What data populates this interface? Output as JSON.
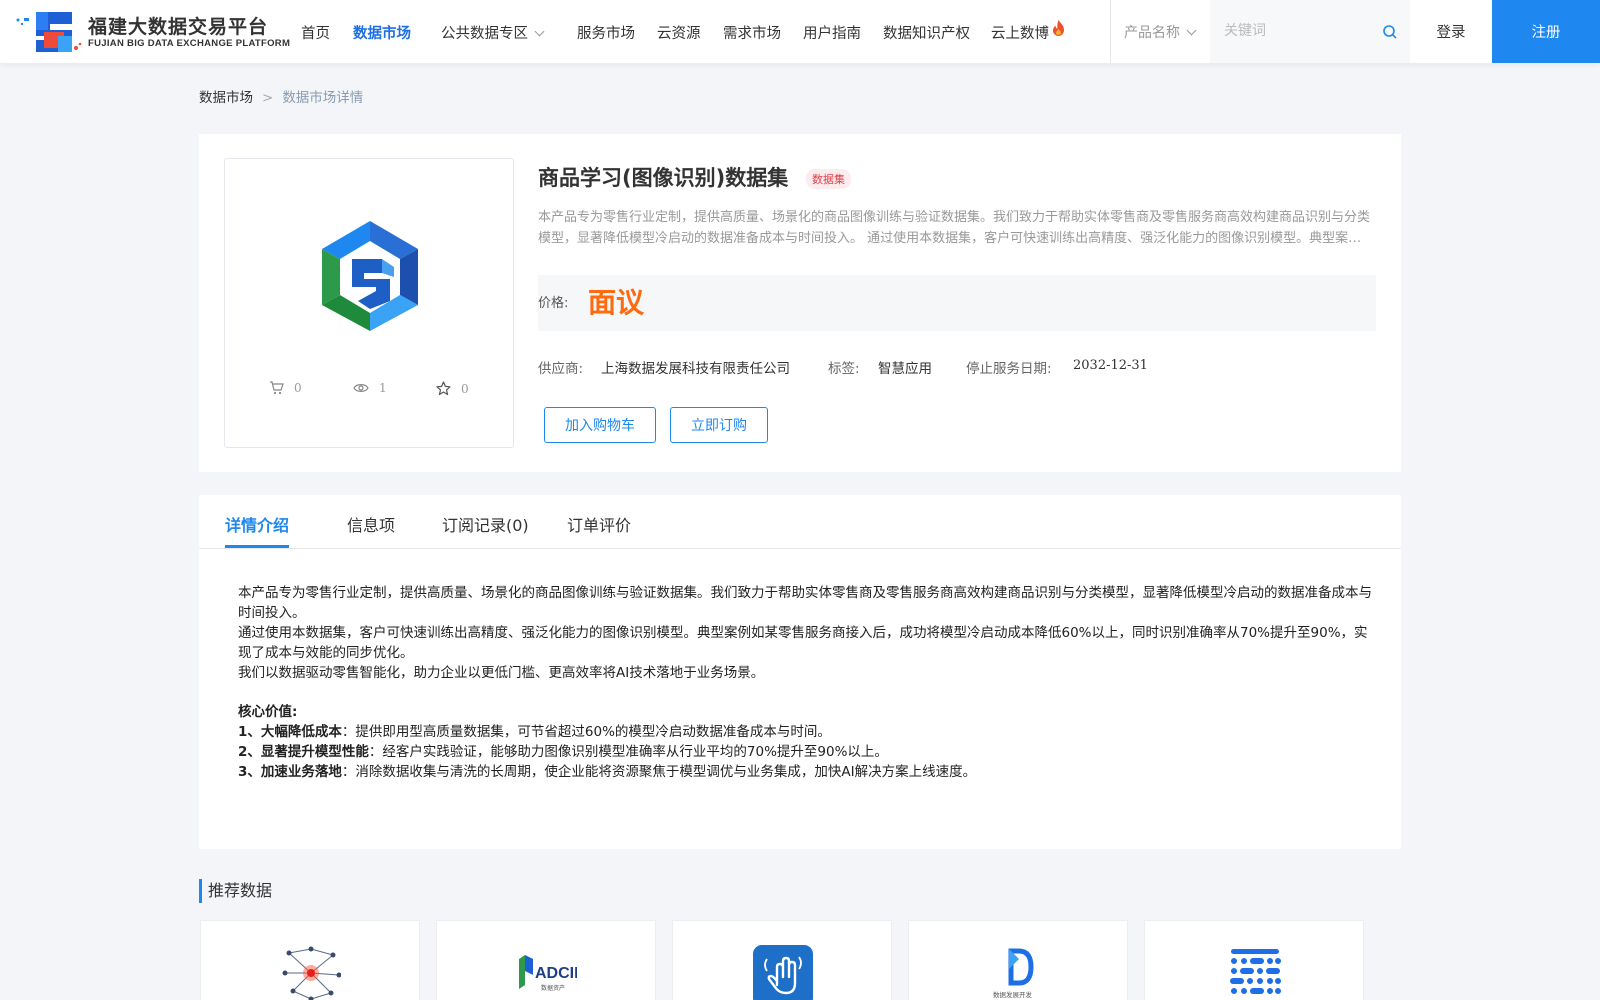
{
  "header": {
    "logo_cn": "福建大数据交易平台",
    "logo_en": "FUJIAN BIG DATA EXCHANGE  PLATFORM",
    "nav": [
      {
        "label": "首页"
      },
      {
        "label": "数据市场"
      },
      {
        "label": "公共数据专区"
      },
      {
        "label": "服务市场"
      },
      {
        "label": "云资源"
      },
      {
        "label": "需求市场"
      },
      {
        "label": "用户指南"
      },
      {
        "label": "数据知识产权"
      },
      {
        "label": "云上数博"
      }
    ],
    "search_type": "产品名称",
    "search_placeholder": "关键词",
    "login": "登录",
    "register": "注册",
    "colors": {
      "accent": "#1e88f0",
      "active_nav": "#1e6fe6",
      "price": "#ff6a0e"
    }
  },
  "breadcrumb": {
    "root": "数据市场",
    "separator": ">",
    "current": "数据市场详情"
  },
  "product": {
    "title": "商品学习(图像识别)数据集",
    "tag": "数据集",
    "description": "本产品专为零售行业定制，提供高质量、场景化的商品图像训练与验证数据集。我们致力于帮助实体零售商及零售服务商高效构建商品识别与分类模型，显著降低模型冷启动的数据准备成本与时间投入。 通过使用本数据集，客户可快速训练出高精度、强泛化能力的图像识别模型。典型案例如某零售服务商接入后，成功将模型冷启动成本降低60%以上，同时识别准确率从70%提升至90%，实现了成本与效能的同步优化。",
    "price_label": "价格:",
    "price_value": "面议",
    "stats": {
      "cart": "0",
      "views": "1",
      "favorites": "0"
    },
    "supplier_label": "供应商:",
    "supplier": "上海数据发展科技有限责任公司",
    "tags_label": "标签:",
    "tags_value": "智慧应用",
    "end_date_label": "停止服务日期:",
    "end_date": "2032-12-31",
    "add_cart": "加入购物车",
    "buy_now": "立即订购"
  },
  "detail": {
    "tabs": [
      {
        "label": "详情介绍"
      },
      {
        "label": "信息项"
      },
      {
        "label": "订阅记录(0)"
      },
      {
        "label": "订单评价"
      }
    ],
    "paragraphs": [
      "本产品专为零售行业定制，提供高质量、场景化的商品图像训练与验证数据集。我们致力于帮助实体零售商及零售服务商高效构建商品识别与分类模型，显著降低模型冷启动的数据准备成本与时间投入。",
      "通过使用本数据集，客户可快速训练出高精度、强泛化能力的图像识别模型。典型案例如某零售服务商接入后，成功将模型冷启动成本降低60%以上，同时识别准确率从70%提升至90%，实现了成本与效能的同步优化。",
      "我们以数据驱动零售智能化，助力企业以更低门槛、更高效率将AI技术落地于业务场景。"
    ],
    "core_title": "核心价值:",
    "core_items": [
      {
        "label": "1、大幅降低成本",
        "text": "：提供即用型高质量数据集，可节省超过60%的模型冷启动数据准备成本与时间。"
      },
      {
        "label": "2、显著提升模型性能",
        "text": "：经客户实践验证，能够助力图像识别模型准确率从行业平均的70%提升至90%以上。"
      },
      {
        "label": "3、加速业务落地",
        "text": "：消除数据收集与清洗的长周期，使企业能将资源聚焦于模型调优与业务集成，加快AI解决方案上线速度。"
      }
    ]
  },
  "recommend": {
    "title": "推荐数据",
    "items": [
      {
        "icon": "network-graph-icon"
      },
      {
        "icon": "adcid-logo-icon"
      },
      {
        "icon": "hand-signal-app-icon"
      },
      {
        "icon": "blue-d-logo-icon"
      },
      {
        "icon": "dot-grid-logo-icon"
      }
    ]
  }
}
